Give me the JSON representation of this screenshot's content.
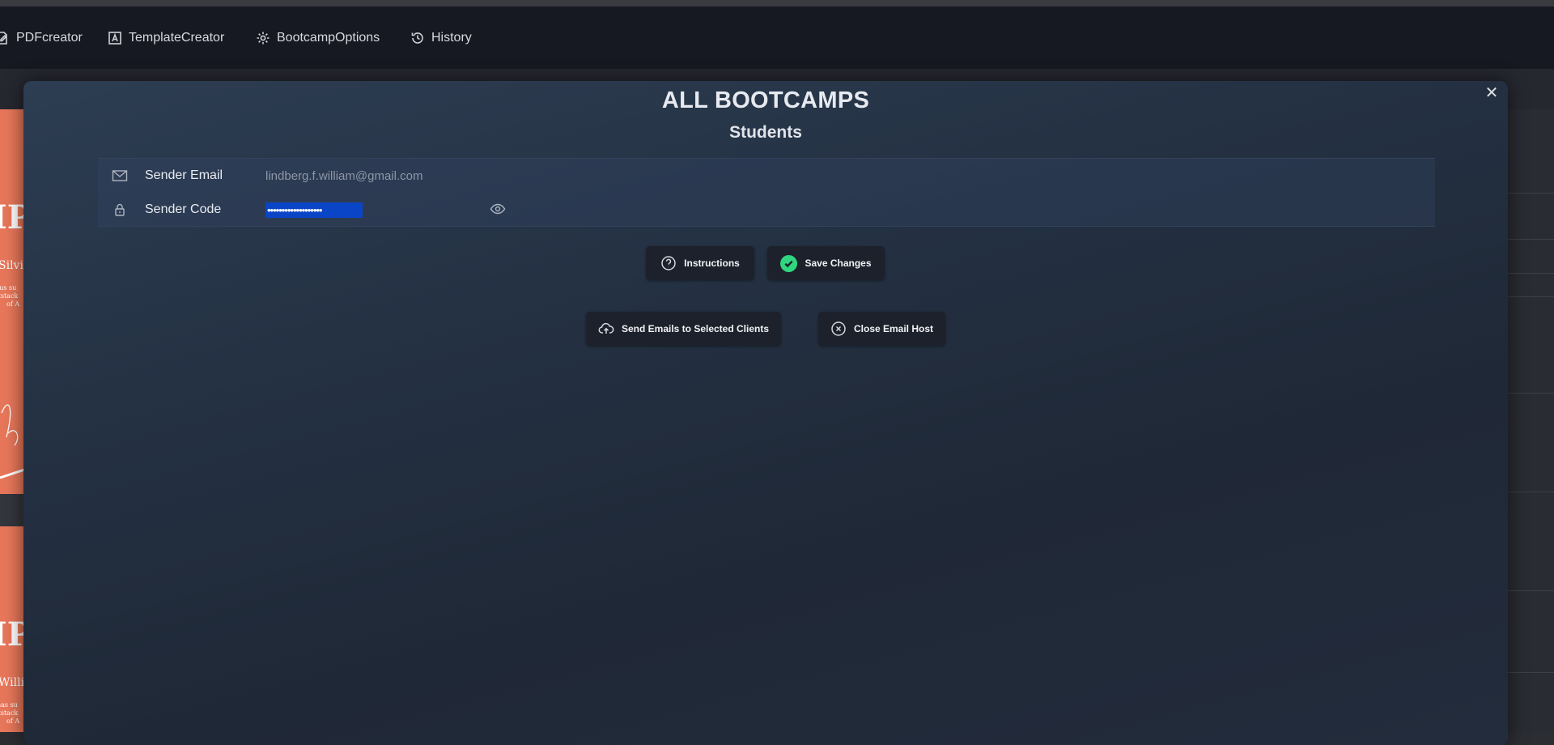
{
  "nav": {
    "items": [
      {
        "label": "PDFcreator",
        "icon": "edit-doc-icon"
      },
      {
        "label": "TemplateCreator",
        "icon": "template-icon"
      },
      {
        "label": "BootcampOptions",
        "icon": "gear-icon"
      },
      {
        "label": "History",
        "icon": "history-icon"
      }
    ]
  },
  "background": {
    "cert_a": {
      "big": "IP",
      "name": "Silvi",
      "line1": "Jus su",
      "line2": "kstack",
      "line3": "of A"
    },
    "cert_b": {
      "big": "IP",
      "name": "Willia",
      "line1": "has su",
      "line2": "kstack",
      "line3": "of A"
    }
  },
  "modal": {
    "title": "ALL BOOTCAMPS",
    "subtitle": "Students",
    "close_symbol": "✕",
    "fields": {
      "email_label": "Sender Email",
      "email_value": "lindberg.f.william@gmail.com",
      "code_label": "Sender Code",
      "code_value": "•••••••••••••••••••"
    },
    "buttons": {
      "instructions": "Instructions",
      "save": "Save Changes",
      "send": "Send Emails to Selected Clients",
      "close_host": "Close Email Host"
    }
  },
  "colors": {
    "accent_green": "#2fd67f",
    "selection_blue": "#0b45c7",
    "cert_orange": "#e8775a"
  }
}
